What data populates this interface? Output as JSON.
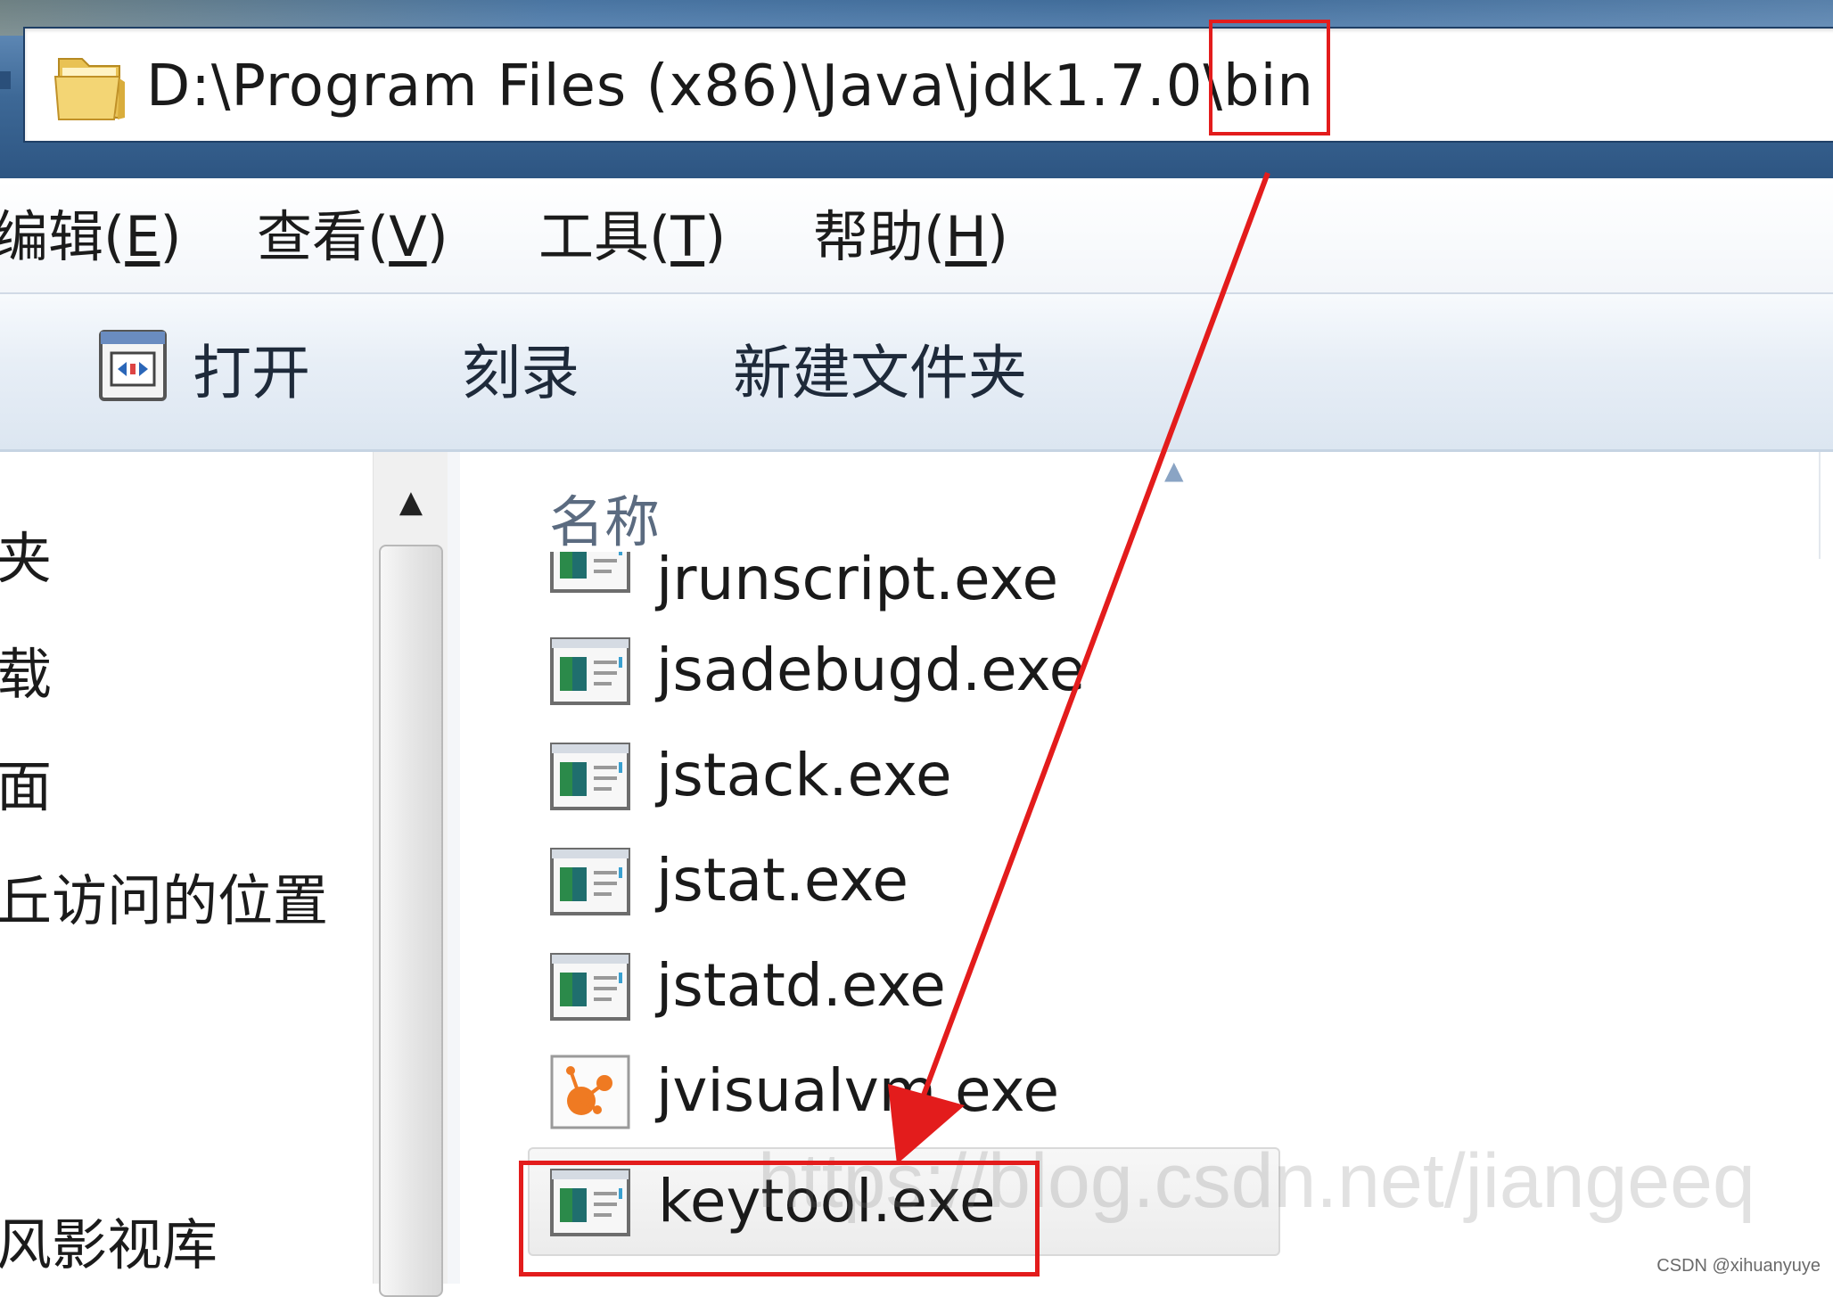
{
  "address_bar": {
    "path": "D:\\Program Files (x86)\\Java\\jdk1.7.0\\bin",
    "highlighted_segment": "bin"
  },
  "menu": [
    {
      "label": "编辑(",
      "accel": "E",
      "close": ")"
    },
    {
      "label": "查看(",
      "accel": "V",
      "close": ")"
    },
    {
      "label": "工具(",
      "accel": "T",
      "close": ")"
    },
    {
      "label": "帮助(",
      "accel": "H",
      "close": ")"
    }
  ],
  "toolbar": {
    "open_label": "打开",
    "burn_label": "刻录",
    "new_folder_label": "新建文件夹"
  },
  "nav": {
    "items": [
      "夹",
      "载",
      "面",
      "丘访问的位置",
      "风影视库"
    ]
  },
  "file_list": {
    "column_name": "名称",
    "files": [
      {
        "name": "jrunscript.exe",
        "icon": "console-app-icon"
      },
      {
        "name": "jsadebugd.exe",
        "icon": "console-app-icon"
      },
      {
        "name": "jstack.exe",
        "icon": "console-app-icon"
      },
      {
        "name": "jstat.exe",
        "icon": "console-app-icon"
      },
      {
        "name": "jstatd.exe",
        "icon": "console-app-icon"
      },
      {
        "name": "jvisualvm.exe",
        "icon": "visualvm-icon"
      },
      {
        "name": "keytool.exe",
        "icon": "console-app-icon",
        "selected": true
      }
    ]
  },
  "annotation": {
    "color": "#e31c1c",
    "arrow_from": "bin",
    "arrow_to": "keytool.exe"
  },
  "watermark": "https://blog.csdn.net/jiangeeq",
  "credit": "CSDN @xihuanyuye"
}
